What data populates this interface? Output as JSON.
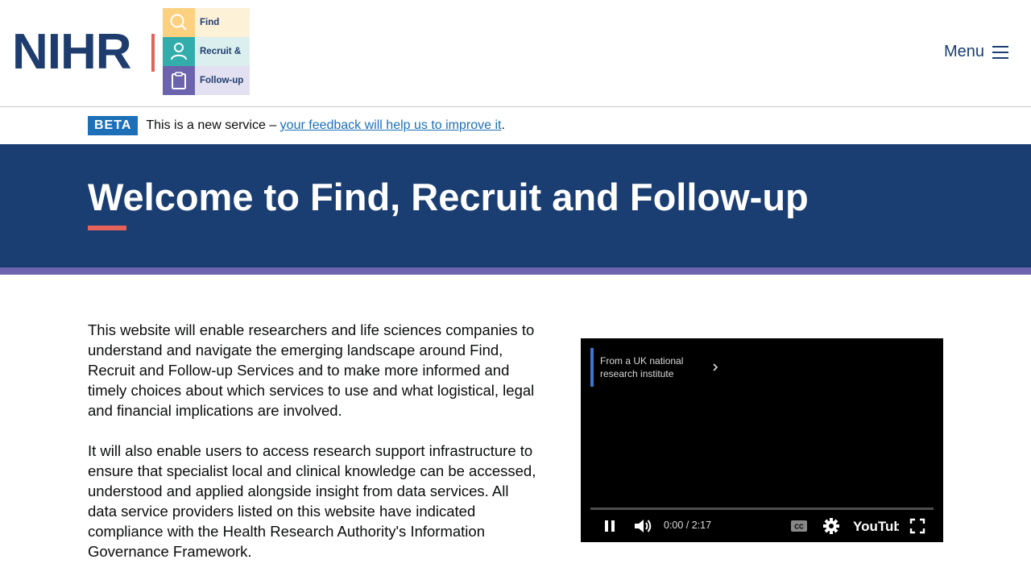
{
  "header": {
    "logo_text": "NIHR",
    "logo_tiles": [
      "Find",
      "Recruit &",
      "Follow-up"
    ],
    "menu_label": "Menu"
  },
  "beta": {
    "tag": "BETA",
    "text": "This is a new service – ",
    "link": "your feedback will help us to improve it",
    "suffix": "."
  },
  "hero": {
    "title": "Welcome to Find, Recruit and Follow-up"
  },
  "content": {
    "paragraphs": [
      "This website will enable researchers and life sciences companies to understand and navigate the emerging landscape around Find, Recruit and Follow-up Services and to make more informed and timely choices about which services to use and what logistical, legal and financial implications are involved.",
      "It will also enable users to access research support infrastructure to ensure that specialist local and clinical knowledge can be accessed, understood and applied alongside insight from data services. All data service providers listed on this website have indicated compliance with the Health Research Authority's Information Governance Framework."
    ]
  },
  "video": {
    "info_card": "From a UK national research institute",
    "time": "0:00 / 2:17",
    "brand": "YouTube",
    "progress": 0
  },
  "colors": {
    "navy": "#1b3e72",
    "coral": "#e5625b",
    "purple": "#6b63ad",
    "link_blue": "#1d70b8"
  }
}
